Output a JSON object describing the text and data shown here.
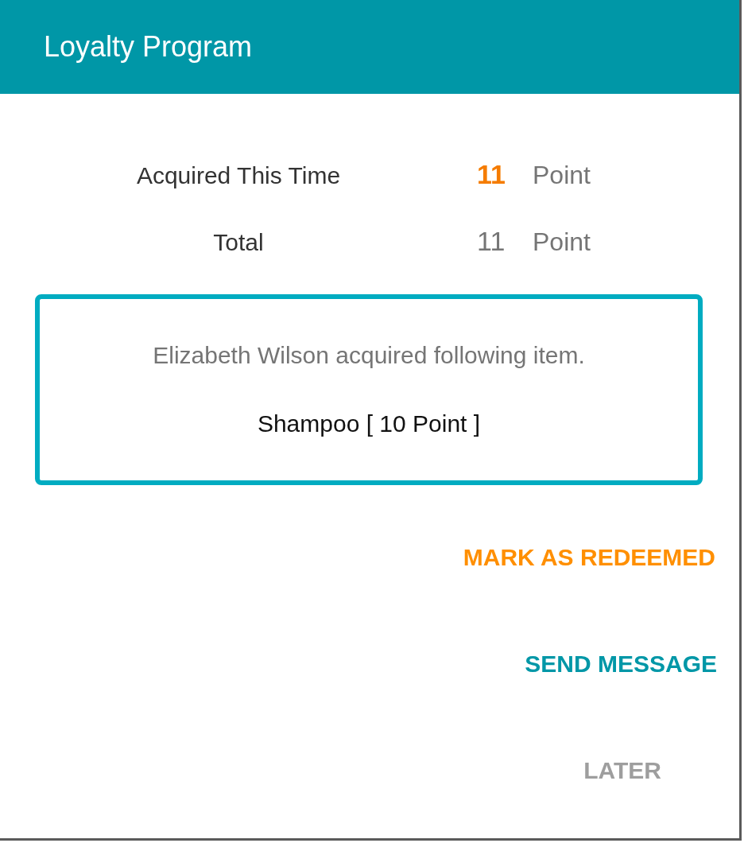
{
  "dialog": {
    "title": "Loyalty Program"
  },
  "points": [
    {
      "label": "Acquired This Time",
      "value": "11",
      "unit": "Point",
      "highlighted": true
    },
    {
      "label": "Total",
      "value": "11",
      "unit": "Point",
      "highlighted": false
    }
  ],
  "notice": {
    "message": "Elizabeth Wilson acquired following item.",
    "item": "Shampoo [ 10 Point ]"
  },
  "buttons": [
    {
      "label": "MARK AS REDEEMED",
      "kind": "accent"
    },
    {
      "label": "SEND MESSAGE",
      "kind": "primary"
    },
    {
      "label": "LATER",
      "kind": "neutral"
    }
  ]
}
